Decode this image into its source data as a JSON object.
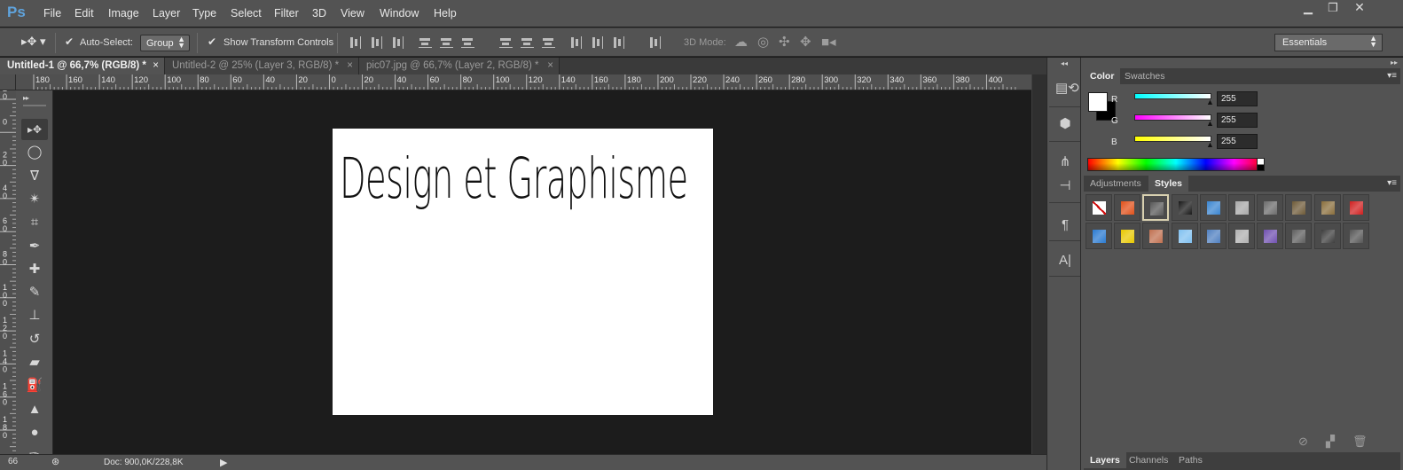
{
  "app": {
    "logo": "Ps",
    "menu": [
      "File",
      "Edit",
      "Image",
      "Layer",
      "Type",
      "Select",
      "Filter",
      "3D",
      "View",
      "Window",
      "Help"
    ],
    "window_buttons": [
      "minimize",
      "restore",
      "close"
    ]
  },
  "options_bar": {
    "auto_select_label": "Auto-Select:",
    "auto_select_checked": true,
    "auto_select_target": "Group",
    "show_transform_label": "Show Transform Controls",
    "show_transform_checked": true,
    "mode_3d_label": "3D Mode:",
    "workspace": "Essentials"
  },
  "tabs": [
    {
      "label": "Untitled-1 @ 66,7% (RGB/8) *",
      "active": true
    },
    {
      "label": "Untitled-2 @ 25% (Layer 3, RGB/8) *",
      "active": false
    },
    {
      "label": "pic07.jpg @ 66,7% (Layer 2, RGB/8) *",
      "active": false
    }
  ],
  "ruler_top": [
    "180",
    "160",
    "140",
    "120",
    "100",
    "80",
    "60",
    "40",
    "20",
    "0",
    "20",
    "40",
    "60",
    "80",
    "100",
    "120",
    "140",
    "160",
    "180",
    "200",
    "220",
    "240",
    "260",
    "280",
    "300",
    "320",
    "340",
    "360",
    "380",
    "400"
  ],
  "ruler_left": [
    "20",
    "0",
    "20",
    "40",
    "60",
    "80",
    "100",
    "120",
    "140",
    "160",
    "180"
  ],
  "tools": [
    {
      "name": "move-tool-icon",
      "glyph": "▸✥"
    },
    {
      "name": "marquee-tool-icon",
      "glyph": "◯"
    },
    {
      "name": "lasso-tool-icon",
      "glyph": "ᐁ"
    },
    {
      "name": "magic-wand-tool-icon",
      "glyph": "✴"
    },
    {
      "name": "crop-tool-icon",
      "glyph": "⌗"
    },
    {
      "name": "eyedropper-tool-icon",
      "glyph": "✒"
    },
    {
      "name": "healing-brush-tool-icon",
      "glyph": "✚"
    },
    {
      "name": "brush-tool-icon",
      "glyph": "✎"
    },
    {
      "name": "clone-stamp-tool-icon",
      "glyph": "⊥"
    },
    {
      "name": "history-brush-tool-icon",
      "glyph": "↺"
    },
    {
      "name": "eraser-tool-icon",
      "glyph": "▰"
    },
    {
      "name": "paint-bucket-tool-icon",
      "glyph": "⛽"
    },
    {
      "name": "blur-tool-icon",
      "glyph": "▲"
    },
    {
      "name": "dodge-tool-icon",
      "glyph": "●"
    },
    {
      "name": "pen-tool-icon",
      "glyph": "✑"
    }
  ],
  "document": {
    "text": "Design et Graphisme",
    "background_color": "#ffffff"
  },
  "status": {
    "zoom": "66",
    "doc_info": "Doc: 900,0K/228,8K"
  },
  "dock_icons": [
    "history-icon",
    "properties-3d-icon",
    "brush-presets-icon",
    "clone-source-icon",
    "paragraph-icon",
    "character-icon"
  ],
  "color_panel": {
    "tabs": [
      {
        "label": "Color",
        "active": true
      },
      {
        "label": "Swatches",
        "active": false
      }
    ],
    "foreground": "#ffffff",
    "background": "#000000",
    "channels": [
      {
        "label": "R",
        "value": "255",
        "color_from": "#ffffff",
        "color_to": "#00ffff"
      },
      {
        "label": "G",
        "value": "255",
        "color_from": "#ffffff",
        "color_to": "#ff00ff"
      },
      {
        "label": "B",
        "value": "255",
        "color_from": "#ffffff",
        "color_to": "#ffff00"
      }
    ]
  },
  "styles_panel": {
    "tabs": [
      {
        "label": "Adjustments",
        "active": false
      },
      {
        "label": "Styles",
        "active": true
      }
    ],
    "styles": [
      {
        "name": "none-style",
        "color": "#ffffff"
      },
      {
        "name": "red-glow-style",
        "color": "#e0501a"
      },
      {
        "name": "beveled-frame-style",
        "color": "#585858"
      },
      {
        "name": "dark-button-style",
        "color": "#1a1a1a"
      },
      {
        "name": "blue-glass-style",
        "color": "#3a85d0"
      },
      {
        "name": "silver-style",
        "color": "#a8a8a8"
      },
      {
        "name": "chrome-style",
        "color": "#6c6c6c"
      },
      {
        "name": "bronze-style",
        "color": "#6e5a38"
      },
      {
        "name": "gold-metal-style",
        "color": "#8a6e3c"
      },
      {
        "name": "red-gel-style",
        "color": "#d02020"
      },
      {
        "name": "rainbow-style",
        "color": "#2a7ad0"
      },
      {
        "name": "yellow-style",
        "color": "#e8c800"
      },
      {
        "name": "copper-style",
        "color": "#c07050"
      },
      {
        "name": "sky-blue-style",
        "color": "#80c0f0"
      },
      {
        "name": "sunset-style",
        "color": "#5080c0"
      },
      {
        "name": "sparkle-style",
        "color": "#b0b0b0"
      },
      {
        "name": "purple-style",
        "color": "#7050b0"
      },
      {
        "name": "gray-style",
        "color": "#5e5e5e"
      },
      {
        "name": "dark-gray-style",
        "color": "#3e3e3e"
      },
      {
        "name": "medium-gray-style",
        "color": "#565656"
      }
    ]
  },
  "layers_panel": {
    "tabs": [
      {
        "label": "Layers",
        "active": true
      },
      {
        "label": "Channels",
        "active": false
      },
      {
        "label": "Paths",
        "active": false
      }
    ]
  }
}
